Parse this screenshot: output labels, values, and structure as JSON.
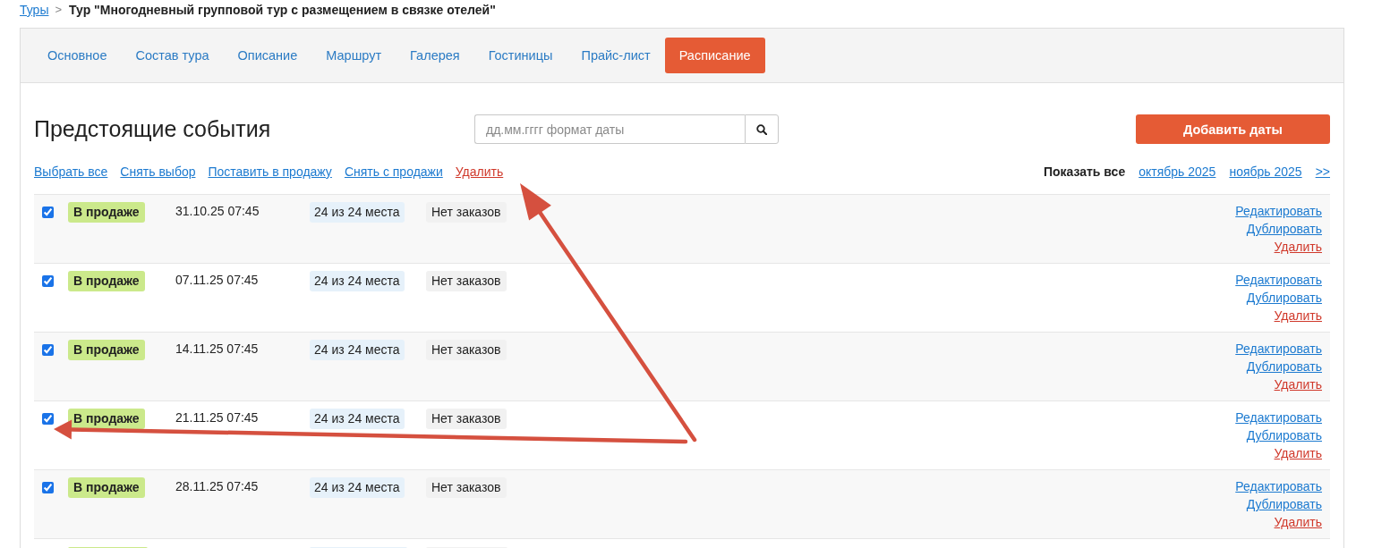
{
  "breadcrumb": {
    "link": "Туры",
    "separator": ">",
    "title": "Тур \"Многодневный групповой тур с размещением в связке отелей\""
  },
  "tabs": [
    {
      "label": "Основное",
      "selected": false
    },
    {
      "label": "Состав тура",
      "selected": false
    },
    {
      "label": "Описание",
      "selected": false
    },
    {
      "label": "Маршрут",
      "selected": false
    },
    {
      "label": "Галерея",
      "selected": false
    },
    {
      "label": "Гостиницы",
      "selected": false
    },
    {
      "label": "Прайс-лист",
      "selected": false
    },
    {
      "label": "Расписание",
      "selected": true
    }
  ],
  "header": {
    "title": "Предстоящие события",
    "search": {
      "placeholder": "дд.мм.гггг формат даты"
    },
    "add_button": "Добавить даты"
  },
  "bulk_actions": [
    {
      "label": "Выбрать все",
      "kind": "link"
    },
    {
      "label": "Снять выбор",
      "kind": "link"
    },
    {
      "label": "Поставить в продажу",
      "kind": "link"
    },
    {
      "label": "Снять с продажи",
      "kind": "link"
    },
    {
      "label": "Удалить",
      "kind": "danger"
    }
  ],
  "filter": {
    "label": "Показать все",
    "months": [
      "октябрь 2025",
      "ноябрь 2025"
    ],
    "next": ">>"
  },
  "rows": [
    {
      "cut_off": false,
      "checked": true,
      "status": {
        "label": "В продаже",
        "kind": "on_sale"
      },
      "datetime": "31.10.25 07:45",
      "places": "24 из 24 места",
      "orders": "Нет заказов",
      "actions": [
        {
          "label": "Редактировать",
          "kind": "link"
        },
        {
          "label": "Дублировать",
          "kind": "link"
        },
        {
          "label": "Удалить",
          "kind": "danger"
        }
      ]
    },
    {
      "cut_off": false,
      "checked": true,
      "status": {
        "label": "В продаже",
        "kind": "on_sale"
      },
      "datetime": "07.11.25 07:45",
      "places": "24 из 24 места",
      "orders": "Нет заказов",
      "actions": [
        {
          "label": "Редактировать",
          "kind": "link"
        },
        {
          "label": "Дублировать",
          "kind": "link"
        },
        {
          "label": "Удалить",
          "kind": "danger"
        }
      ]
    },
    {
      "cut_off": false,
      "checked": true,
      "status": {
        "label": "В продаже",
        "kind": "on_sale"
      },
      "datetime": "14.11.25 07:45",
      "places": "24 из 24 места",
      "orders": "Нет заказов",
      "actions": [
        {
          "label": "Редактировать",
          "kind": "link"
        },
        {
          "label": "Дублировать",
          "kind": "link"
        },
        {
          "label": "Удалить",
          "kind": "danger"
        }
      ]
    },
    {
      "cut_off": false,
      "checked": true,
      "status": {
        "label": "В продаже",
        "kind": "on_sale"
      },
      "datetime": "21.11.25 07:45",
      "places": "24 из 24 места",
      "orders": "Нет заказов",
      "actions": [
        {
          "label": "Редактировать",
          "kind": "link"
        },
        {
          "label": "Дублировать",
          "kind": "link"
        },
        {
          "label": "Удалить",
          "kind": "danger"
        }
      ]
    },
    {
      "cut_off": false,
      "checked": true,
      "status": {
        "label": "В продаже",
        "kind": "on_sale"
      },
      "datetime": "28.11.25 07:45",
      "places": "24 из 24 места",
      "orders": "Нет заказов",
      "actions": [
        {
          "label": "Редактировать",
          "kind": "link"
        },
        {
          "label": "Дублировать",
          "kind": "link"
        },
        {
          "label": "Удалить",
          "kind": "danger"
        }
      ]
    },
    {
      "cut_off": true,
      "status": {
        "kind": "on_sale"
      }
    }
  ],
  "annotations": [
    {
      "kind": "arrow"
    },
    {
      "kind": "arrow"
    }
  ]
}
